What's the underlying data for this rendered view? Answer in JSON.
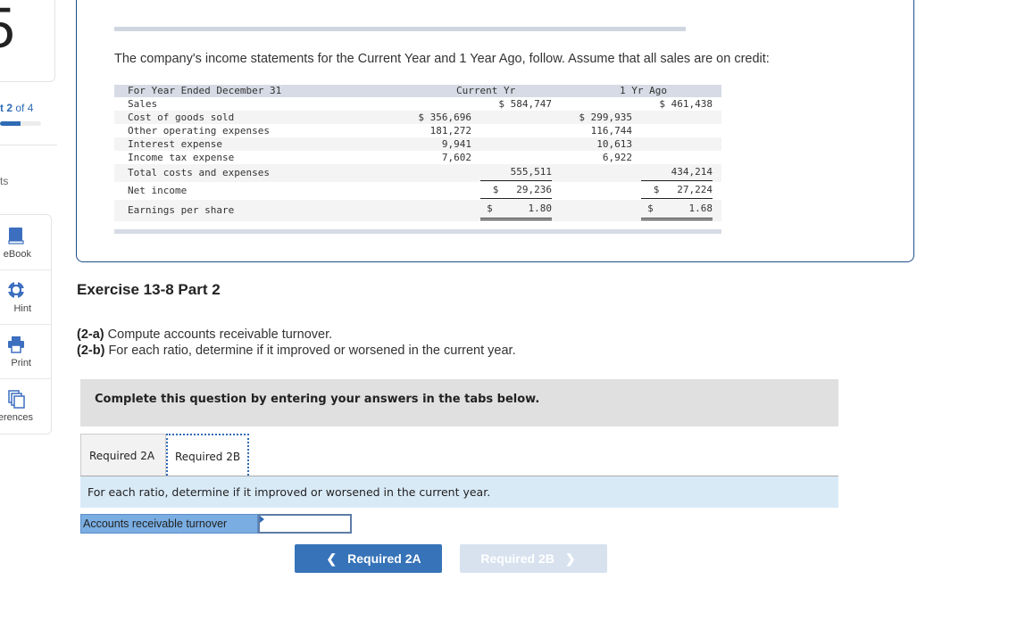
{
  "sidebar": {
    "question_number": "5",
    "part_label_prefix": "t",
    "part_current": "2",
    "part_total_label": "of 4",
    "part_progress": 0.5,
    "points_label": "ts",
    "tools": [
      {
        "icon": "book-icon",
        "label": "eBook"
      },
      {
        "icon": "lifebuoy-icon",
        "label": "Hint"
      },
      {
        "icon": "printer-icon",
        "label": "Print"
      },
      {
        "icon": "copy-icon",
        "label": "ferences"
      }
    ]
  },
  "intro_text": "The company's income statements for the Current Year and 1 Year Ago, follow. Assume that all sales are on credit:",
  "statement": {
    "header_label": "For Year Ended December 31",
    "col_current": "Current Yr",
    "col_ago": "1 Yr Ago",
    "rows": [
      {
        "label": "Sales",
        "cur_detail": "",
        "cur_total": "$ 584,747",
        "ago_detail": "",
        "ago_total": "$ 461,438"
      },
      {
        "label": "Cost of goods sold",
        "cur_detail": "$ 356,696",
        "cur_total": "",
        "ago_detail": "$ 299,935",
        "ago_total": ""
      },
      {
        "label": "Other operating expenses",
        "cur_detail": "181,272",
        "cur_total": "",
        "ago_detail": "116,744",
        "ago_total": ""
      },
      {
        "label": "Interest expense",
        "cur_detail": "9,941",
        "cur_total": "",
        "ago_detail": "10,613",
        "ago_total": ""
      },
      {
        "label": "Income tax expense",
        "cur_detail": "7,602",
        "cur_total": "",
        "ago_detail": "6,922",
        "ago_total": ""
      },
      {
        "label": "Total costs and expenses",
        "cur_detail": "",
        "cur_total": "555,511",
        "ago_detail": "",
        "ago_total": "434,214"
      },
      {
        "label": "Net income",
        "cur_detail": "",
        "cur_total": "$   29,236",
        "ago_detail": "",
        "ago_total": "$   27,224"
      },
      {
        "label": "Earnings per share",
        "cur_detail": "",
        "cur_total": "$      1.80",
        "ago_detail": "",
        "ago_total": "$      1.68"
      }
    ]
  },
  "exercise": {
    "title": "Exercise 13-8 Part 2",
    "req_a_tag": "(2-a)",
    "req_a_text": " Compute accounts receivable turnover.",
    "req_b_tag": "(2-b)",
    "req_b_text": " For each ratio, determine if it improved or worsened in the current year."
  },
  "complete_banner": "Complete this question by entering your answers in the tabs below.",
  "tabs": [
    {
      "label": "Required 2A",
      "active": false
    },
    {
      "label": "Required 2B",
      "active": true
    }
  ],
  "instruction": "For each ratio, determine if it improved or worsened in the current year.",
  "answer_row": {
    "label": "Accounts receivable turnover",
    "value": ""
  },
  "nav": {
    "prev_label": "Required 2A",
    "next_label": "Required 2B"
  }
}
